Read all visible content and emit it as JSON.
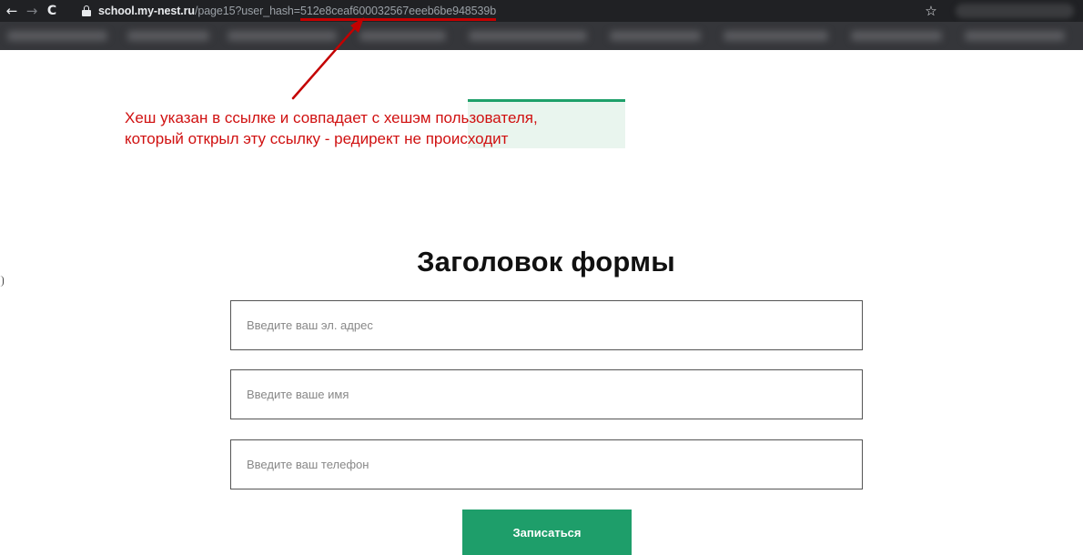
{
  "browser": {
    "back_icon": "←",
    "forward_icon": "→",
    "reload_icon": "C",
    "star_icon": "☆",
    "url_host": "school.my-nest.ru",
    "url_path": "/page15?user_hash=",
    "url_hash": "512e8ceaf600032567eeeb6be948539b"
  },
  "annotation": {
    "line1": "Хеш указан в ссылке и совпадает с хешэм пользователя,",
    "line2": "который открыл эту ссылку - редирект не происходит",
    "color": "#d01010",
    "highlight_color": "#1ea06a"
  },
  "form": {
    "title": "Заголовок формы",
    "email_placeholder": "Введите ваш эл. адрес",
    "name_placeholder": "Введите ваше имя",
    "phone_placeholder": "Введите ваш телефон",
    "submit_label": "Записаться",
    "accent_color": "#1e9e6a"
  }
}
